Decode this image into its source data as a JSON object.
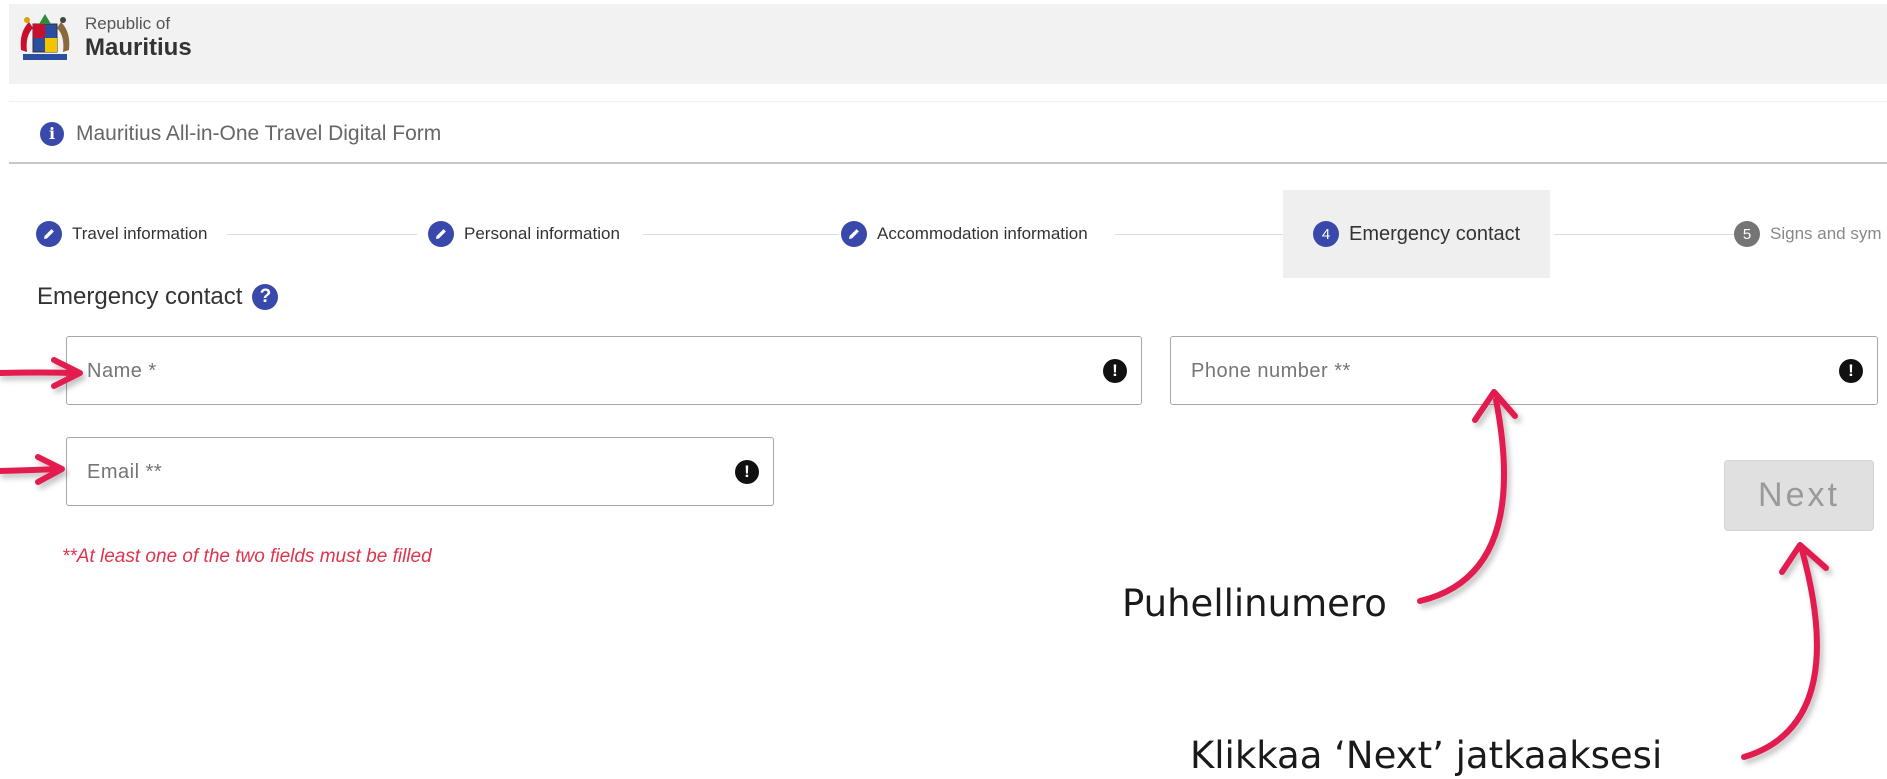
{
  "header": {
    "logo_icon": "mauritius-coat-of-arms",
    "brand_small": "Republic of",
    "brand_big": "Mauritius"
  },
  "infobar": {
    "icon": "info-icon",
    "text": "Mauritius All-in-One Travel Digital Form"
  },
  "steps": [
    {
      "label": "Travel information",
      "state": "completed",
      "icon": "pencil-icon"
    },
    {
      "label": "Personal information",
      "state": "completed",
      "icon": "pencil-icon"
    },
    {
      "label": "Accommodation information",
      "state": "completed",
      "icon": "pencil-icon"
    },
    {
      "number": "4",
      "label": "Emergency contact",
      "state": "active"
    },
    {
      "number": "5",
      "label": "Signs and sym",
      "state": "upcoming"
    }
  ],
  "section": {
    "title": "Emergency contact",
    "help_icon": "question-icon"
  },
  "form": {
    "name_placeholder": "Name *",
    "phone_placeholder": "Phone number **",
    "email_placeholder": "Email **",
    "note": "**At least one of the two fields must be filled",
    "next_label": "Next"
  },
  "annotations": {
    "phone_label": "Puhellinumero",
    "next_label": "Klikkaa ‘Next’ jatkaaksesi"
  },
  "colors": {
    "accent": "#3949ab",
    "error": "#e0334d",
    "arrow": "#e31f4f"
  }
}
